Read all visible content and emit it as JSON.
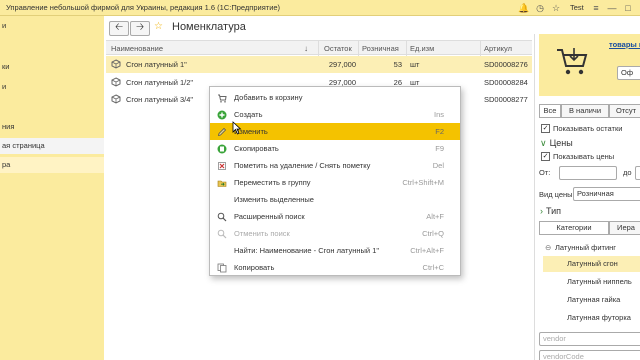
{
  "window": {
    "title": "Управление небольшой фирмой для Украины, редакция 1.6  (1С:Предприятие)",
    "user": "Test"
  },
  "sidebar": {
    "items": [
      {
        "label": "и"
      },
      {
        "label": "ки"
      },
      {
        "label": "и"
      },
      {
        "label": "ния"
      },
      {
        "label": "ая страница"
      },
      {
        "label": "ра"
      }
    ]
  },
  "form": {
    "title": "Номенклатура"
  },
  "table": {
    "columns": [
      "Наименование",
      "Остаток",
      "Розничная",
      "Ед.изм",
      "Артикул"
    ],
    "rows": [
      {
        "name": "Сгон латунный 1\"",
        "stock": "297,000",
        "retail": "53",
        "unit": "шт",
        "sku": "SD00008276"
      },
      {
        "name": "Сгон латунный 1/2\"",
        "stock": "297,000",
        "retail": "26",
        "unit": "шт",
        "sku": "SD00008284"
      },
      {
        "name": "Сгон латунный 3/4\"",
        "stock": "",
        "retail": "",
        "unit": "",
        "sku": "SD00008277"
      }
    ]
  },
  "context_menu": {
    "items": [
      {
        "label": "Добавить в корзину",
        "shortcut": ""
      },
      {
        "label": "Создать",
        "shortcut": "Ins"
      },
      {
        "label": "Изменить",
        "shortcut": "F2"
      },
      {
        "label": "Скопировать",
        "shortcut": "F9"
      },
      {
        "label": "Пометить на удаление / Снять пометку",
        "shortcut": "Del"
      },
      {
        "label": "Переместить в группу",
        "shortcut": "Ctrl+Shift+M"
      },
      {
        "label": "Изменить выделенные",
        "shortcut": ""
      },
      {
        "label": "Расширенный поиск",
        "shortcut": "Alt+F"
      },
      {
        "label": "Отменить поиск",
        "shortcut": "Ctrl+Q"
      },
      {
        "label": "Найти: Наименование - Сгон латунный 1\"",
        "shortcut": "Ctrl+Alt+F"
      },
      {
        "label": "Копировать",
        "shortcut": "Ctrl+C"
      }
    ]
  },
  "right_panel": {
    "cart_link": "товары в",
    "cart_button": "Оф",
    "tabs": [
      "Все",
      "В наличи",
      "Отсут"
    ],
    "show_stock": "Показывать остатки",
    "prices_header": "Цены",
    "show_prices": "Показывать цены",
    "from_label": "От:",
    "to_label": "до",
    "price_type_label": "Вид цены:",
    "price_type_value": "Розничная",
    "type_header": "Тип",
    "category_tabs": [
      "Категории",
      "Иера"
    ],
    "tree_root": "Латунный фитинг",
    "tree_items": [
      "Латунный сгон",
      "Латунный ниппель",
      "Латунная гайка",
      "Латунная футорка"
    ],
    "vendor_placeholder": "vendor",
    "vendor_code_placeholder": "vendorCode"
  },
  "colors": {
    "sidebar_bg": "#fbeb9e",
    "highlight": "#f4c200",
    "selected_row": "#fcefb5"
  }
}
